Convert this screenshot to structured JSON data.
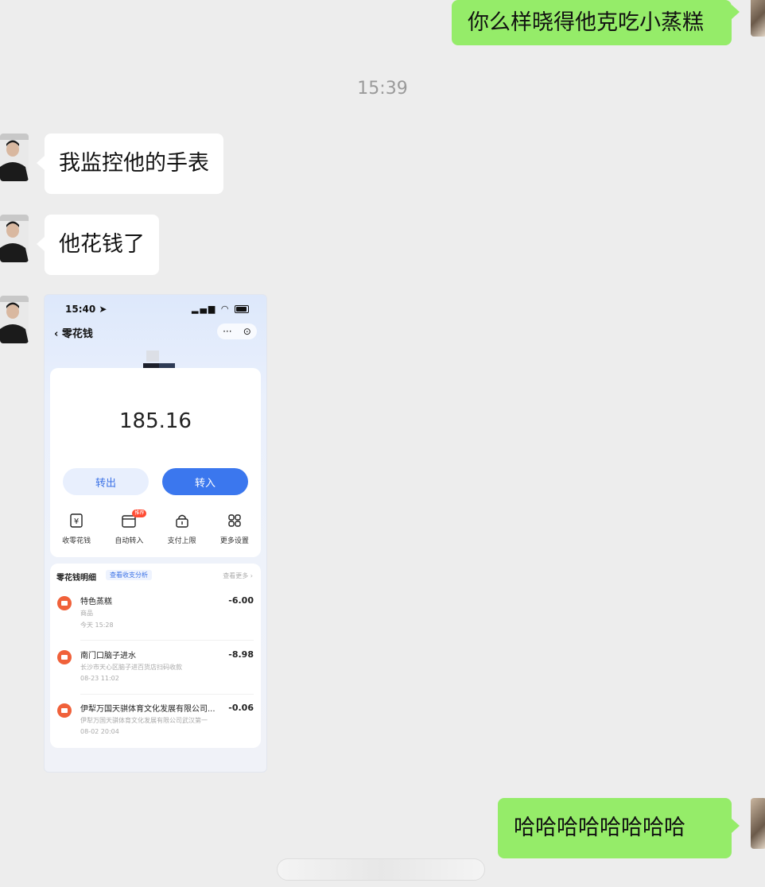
{
  "messages": {
    "msg1": "你么样晓得他克吃小蒸糕",
    "msg2": "我监控他的手表",
    "msg3": "他花钱了",
    "msg4": "哈哈哈哈哈哈哈哈"
  },
  "timestamp": "15:39",
  "screenshot": {
    "status_time": "15:40",
    "back_title": "零花钱",
    "capsule_more": "···",
    "capsule_close": "⊙",
    "amount": "185.16",
    "transfer_out": "转出",
    "transfer_in": "转入",
    "functions": [
      {
        "label": "收零花钱",
        "icon": "yen-box-icon"
      },
      {
        "label": "自动转入",
        "icon": "calendar-icon",
        "badge": "推荐"
      },
      {
        "label": "支付上限",
        "icon": "lock-icon"
      },
      {
        "label": "更多设置",
        "icon": "grid-icon"
      }
    ],
    "list_title": "零花钱明细",
    "analysis_tag": "查看收支分析",
    "more_link": "查看更多",
    "transactions": [
      {
        "title": "特色蒸糕",
        "sub": "商品",
        "date": "今天 15:28",
        "amount": "-6.00"
      },
      {
        "title": "南门口脑子进水",
        "sub": "长沙市天心区脑子进百货店扫码收款",
        "date": "08-23 11:02",
        "amount": "-8.98"
      },
      {
        "title": "伊犁万国天骐体育文化发展有限公司...",
        "sub": "伊犁万国天骐体育文化发展有限公司武汉第一",
        "date": "08-02 20:04",
        "amount": "-0.06"
      }
    ]
  }
}
